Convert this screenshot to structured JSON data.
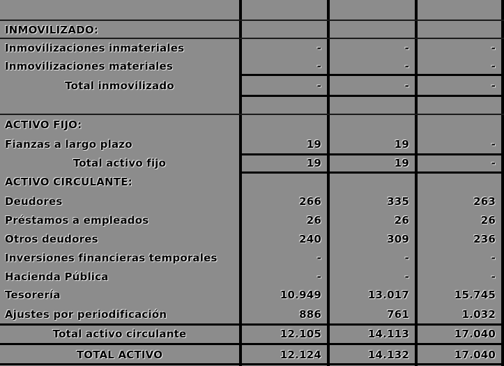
{
  "rows": [
    {
      "label": "",
      "v1": "",
      "v2": "",
      "v3": "",
      "kind": "blank"
    },
    {
      "label": "INMOVILIZADO:",
      "v1": "",
      "v2": "",
      "v3": "",
      "kind": "header"
    },
    {
      "label": "Inmovilizaciones inmateriales",
      "v1": "-",
      "v2": "-",
      "v3": "-",
      "kind": "item"
    },
    {
      "label": "Inmovilizaciones materiales",
      "v1": "-",
      "v2": "-",
      "v3": "-",
      "kind": "item"
    },
    {
      "label": "Total inmovilizado",
      "v1": "-",
      "v2": "-",
      "v3": "-",
      "kind": "total"
    },
    {
      "label": "",
      "v1": "",
      "v2": "",
      "v3": "",
      "kind": "blank"
    },
    {
      "label": "ACTIVO FIJO:",
      "v1": "",
      "v2": "",
      "v3": "",
      "kind": "header"
    },
    {
      "label": "Fianzas a largo plazo",
      "v1": "19",
      "v2": "19",
      "v3": "-",
      "kind": "item"
    },
    {
      "label": "Total activo fijo",
      "v1": "19",
      "v2": "19",
      "v3": "-",
      "kind": "total"
    },
    {
      "label": "ACTIVO CIRCULANTE:",
      "v1": "",
      "v2": "",
      "v3": "",
      "kind": "header"
    },
    {
      "label": "Deudores",
      "v1": "266",
      "v2": "335",
      "v3": "263",
      "kind": "item"
    },
    {
      "label": "Préstamos a empleados",
      "v1": "26",
      "v2": "26",
      "v3": "26",
      "kind": "item"
    },
    {
      "label": "Otros deudores",
      "v1": "240",
      "v2": "309",
      "v3": "236",
      "kind": "item"
    },
    {
      "label": "Inversiones financieras temporales",
      "v1": "-",
      "v2": "-",
      "v3": "-",
      "kind": "item"
    },
    {
      "label": "Hacienda Pública",
      "v1": "-",
      "v2": "-",
      "v3": "-",
      "kind": "item"
    },
    {
      "label": "Tesorería",
      "v1": "10.949",
      "v2": "13.017",
      "v3": "15.745",
      "kind": "item"
    },
    {
      "label": "Ajustes por periodificación",
      "v1": "886",
      "v2": "761",
      "v3": "1.032",
      "kind": "item"
    },
    {
      "label": "Total activo circulante",
      "v1": "12.105",
      "v2": "14.113",
      "v3": "17.040",
      "kind": "total"
    },
    {
      "label": "TOTAL ACTIVO",
      "v1": "12.124",
      "v2": "14.132",
      "v3": "17.040",
      "kind": "total"
    }
  ]
}
